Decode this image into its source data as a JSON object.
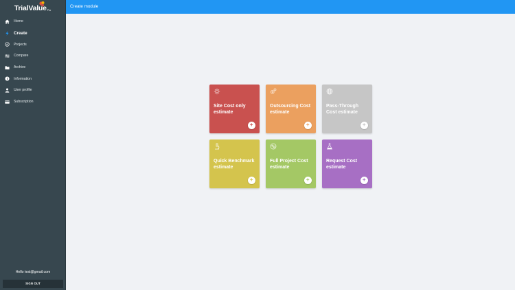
{
  "logo": {
    "text": "TrialValue",
    "sup": "Pro"
  },
  "sidebar": {
    "items": [
      {
        "label": "Home",
        "icon": "home-icon"
      },
      {
        "label": "Create",
        "icon": "lightning-icon"
      },
      {
        "label": "Projects",
        "icon": "projects-icon"
      },
      {
        "label": "Compare",
        "icon": "compare-icon"
      },
      {
        "label": "Archive",
        "icon": "folder-icon"
      },
      {
        "label": "Information",
        "icon": "info-icon"
      },
      {
        "label": "User profile",
        "icon": "user-icon"
      },
      {
        "label": "Subscription",
        "icon": "credit-card-icon"
      }
    ],
    "active_item": "Create",
    "hello_text": "Hello test@gmail.com",
    "sign_out_label": "SIGN OUT"
  },
  "topbar": {
    "title": "Create module"
  },
  "cards": [
    {
      "label": "Site Cost only estimate",
      "color": "#c9514f",
      "icon": "virus-icon"
    },
    {
      "label": "Outsourcing Cost estimate",
      "color": "#eba05f",
      "icon": "gears-icon"
    },
    {
      "label": "Pass-Through Cost estimate",
      "color": "#c6c6c6",
      "icon": "globe-icon"
    },
    {
      "label": "Quick Benchmark estimate",
      "color": "#d4c44d",
      "icon": "microscope-icon"
    },
    {
      "label": "Full Project Cost estimate",
      "color": "#a4c865",
      "icon": "cells-icon"
    },
    {
      "label": "Request Cost estimate",
      "color": "#a76fc4",
      "icon": "flask-icon"
    }
  ],
  "add_symbol": "+",
  "colors": {
    "sidebar": "#37474f",
    "topbar": "#2196f3",
    "background": "#f0f2f5"
  }
}
